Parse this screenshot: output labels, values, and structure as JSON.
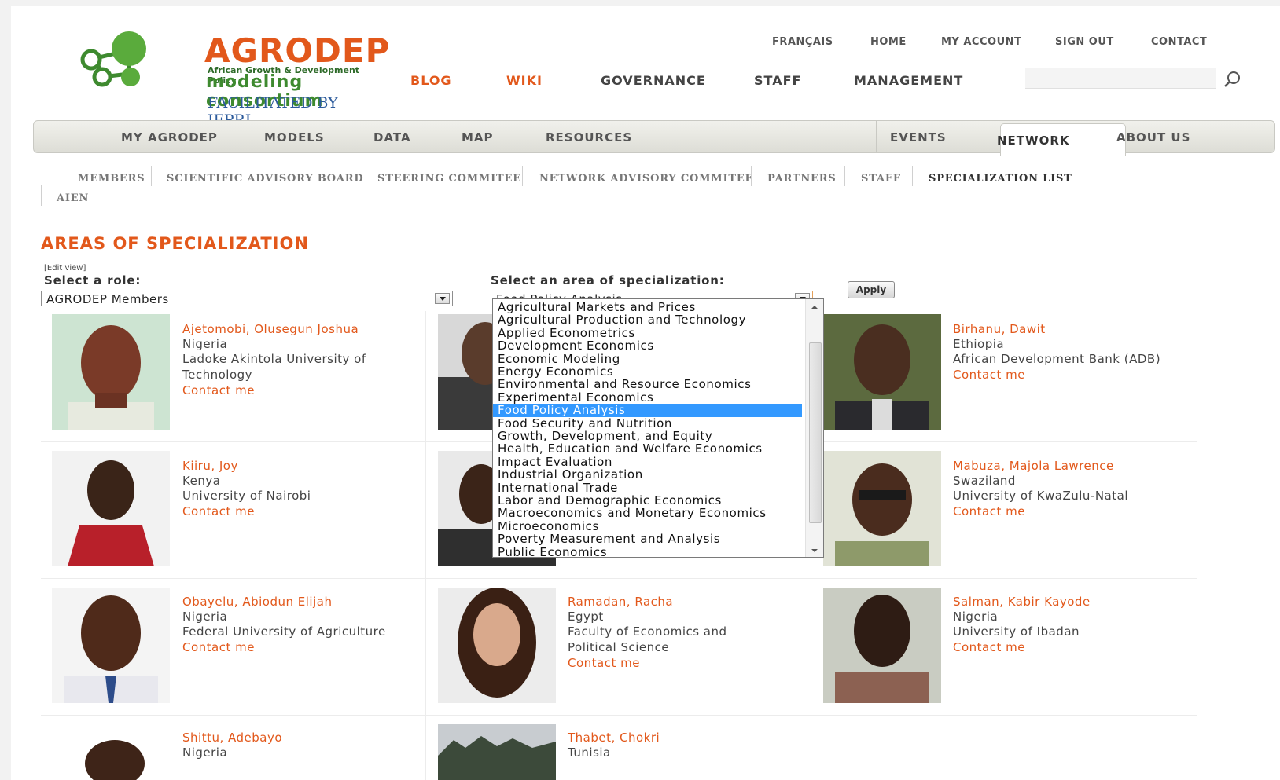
{
  "logo": {
    "name": "AGRODEP",
    "tagline": "African Growth & Development Policy",
    "subtitle": "modeling consortium",
    "facilitated": "FACILITATED BY IFPRI"
  },
  "util_nav": [
    "FRANÇAIS",
    "HOME",
    "MY ACCOUNT",
    "SIGN OUT",
    "CONTACT"
  ],
  "main_links": {
    "blog": "BLOG",
    "wiki": "WIKI",
    "governance": "GOVERNANCE",
    "staff": "STAFF",
    "management": "MANAGEMENT"
  },
  "search": {
    "placeholder": ""
  },
  "tabs": {
    "my_agrodep": "MY AGRODEP",
    "models": "MODELS",
    "data": "DATA",
    "map": "MAP",
    "resources": "RESOURCES",
    "events": "EVENTS",
    "network": "NETWORK",
    "about": "ABOUT US"
  },
  "subnav": {
    "members": "MEMBERS",
    "sab": "SCIENTIFIC ADVISORY BOARD",
    "steering": "STEERING COMMITEE",
    "nac": "NETWORK ADVISORY COMMITEE",
    "partners": "PARTNERS",
    "staff": "STAFF",
    "spec": "SPECIALIZATION LIST",
    "aien": "AIEN"
  },
  "heading": "AREAS OF SPECIALIZATION",
  "edit_view": "[Edit view]",
  "role_label": "Select a role:",
  "role_value": "AGRODEP Members",
  "area_label": "Select an area of specialization:",
  "area_value": "Food Policy Analysis",
  "apply_label": "Apply",
  "area_options": [
    "Agricultural Markets and Prices",
    "Agricultural Production and Technology",
    "Applied Econometrics",
    "Development Economics",
    "Economic Modeling",
    "Energy Economics",
    "Environmental and Resource Economics",
    "Experimental Economics",
    "Food Policy Analysis",
    "Food Security and Nutrition",
    "Growth, Development, and Equity",
    "Health, Education and Welfare Economics",
    "Impact Evaluation",
    "Industrial Organization",
    "International Trade",
    "Labor and Demographic Economics",
    "Macroeconomics and Monetary Economics",
    "Microeconomics",
    "Poverty Measurement and Analysis",
    "Public Economics"
  ],
  "contact_label": "Contact me",
  "members": [
    {
      "name": "Ajetomobi, Olusegun Joshua",
      "country": "Nigeria",
      "inst1": "Ladoke Akintola University of",
      "inst2": "Technology"
    },
    {
      "name": "Birhanu, Dawit",
      "country": "Ethiopia",
      "inst1": "African Development Bank (ADB)",
      "inst2": ""
    },
    {
      "name": "Kiiru, Joy",
      "country": "Kenya",
      "inst1": "University of Nairobi",
      "inst2": ""
    },
    {
      "name": "Mabuza, Majola Lawrence",
      "country": "Swaziland",
      "inst1": "University of KwaZulu-Natal",
      "inst2": ""
    },
    {
      "name": "Obayelu, Abiodun Elijah",
      "country": "Nigeria",
      "inst1": "Federal University of Agriculture",
      "inst2": ""
    },
    {
      "name": "Ramadan, Racha",
      "country": "Egypt",
      "inst1": "Faculty of Economics and",
      "inst2": "Political Science"
    },
    {
      "name": "Salman, Kabir Kayode",
      "country": "Nigeria",
      "inst1": "University of Ibadan",
      "inst2": ""
    },
    {
      "name": "Shittu, Adebayo",
      "country": "Nigeria"
    },
    {
      "name": "Thabet, Chokri",
      "country": "Tunisia"
    }
  ],
  "colors": {
    "brand_orange": "#e2581b",
    "brand_green": "#3e8a2f",
    "ifpri_blue": "#2c5b9c",
    "selected_blue": "#3399ff"
  }
}
